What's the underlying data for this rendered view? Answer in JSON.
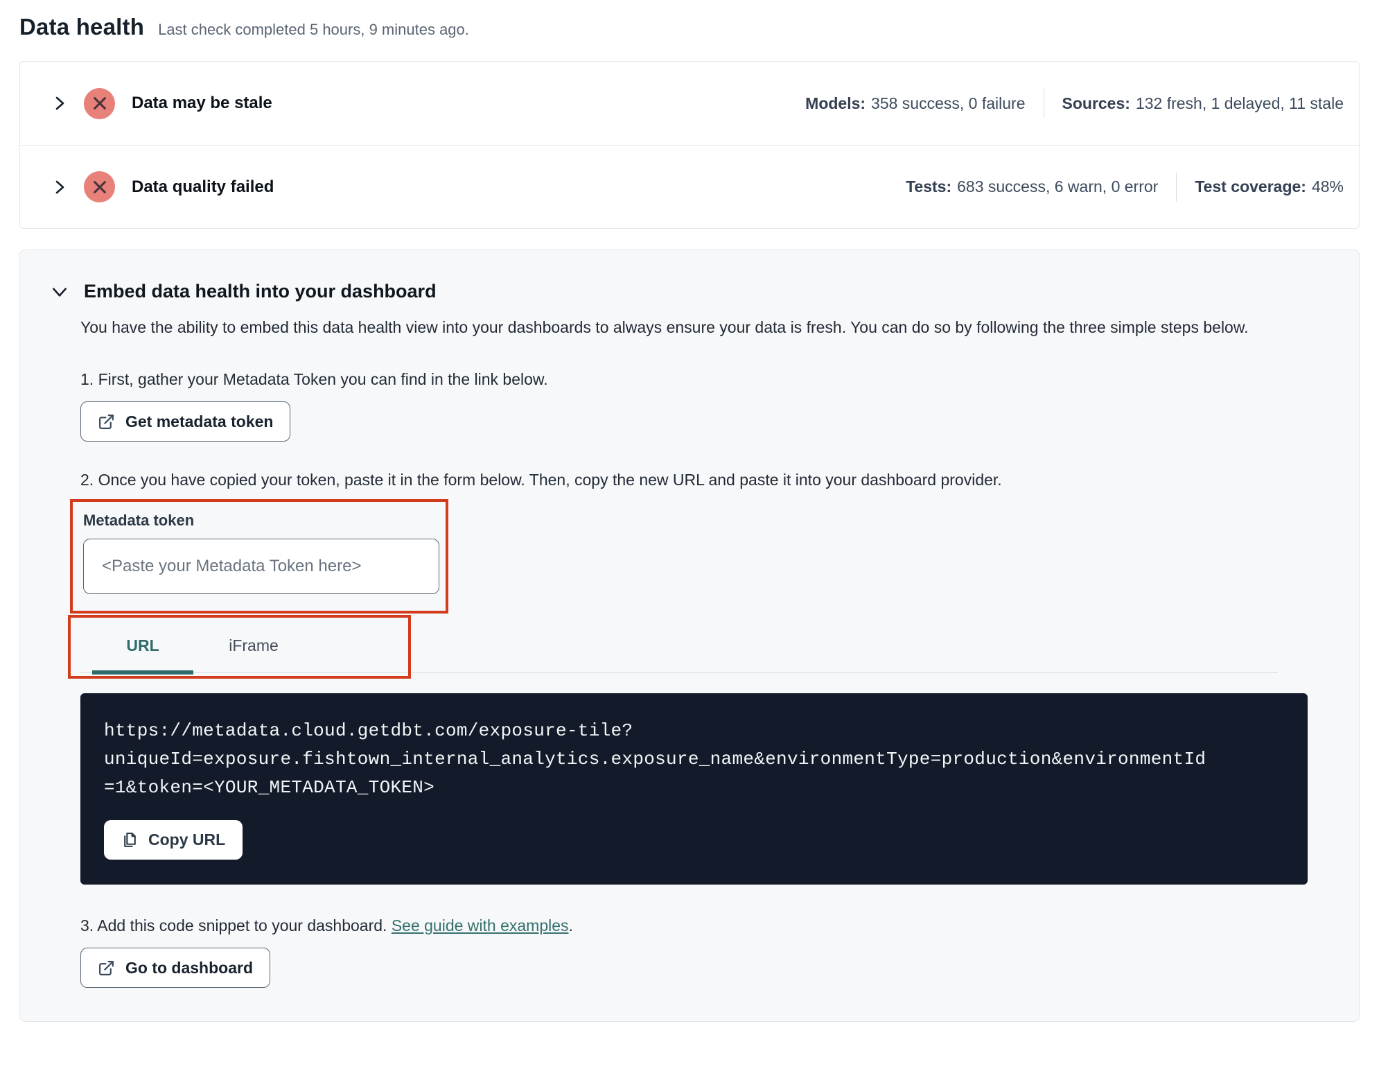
{
  "page": {
    "title": "Data health",
    "subtitle": "Last check completed 5 hours, 9 minutes ago."
  },
  "status_rows": [
    {
      "label": "Data may be stale",
      "status_icon": "error-x-circle",
      "stats": [
        {
          "label": "Models:",
          "value": "358 success, 0 failure"
        },
        {
          "label": "Sources:",
          "value": "132 fresh, 1 delayed, 11 stale"
        }
      ]
    },
    {
      "label": "Data quality failed",
      "status_icon": "error-x-circle",
      "stats": [
        {
          "label": "Tests:",
          "value": "683 success, 6 warn, 0 error"
        },
        {
          "label": "Test coverage:",
          "value": "48%"
        }
      ]
    }
  ],
  "embed": {
    "heading": "Embed data health into your dashboard",
    "description": "You have the ability to embed this data health view into your dashboards to always ensure your data is fresh. You can do so by following the three simple steps below.",
    "step1": "1. First, gather your Metadata Token you can find in the link below.",
    "get_token_button": "Get metadata token",
    "step2": "2. Once you have copied your token, paste it in the form below. Then, copy the new URL and paste it into your dashboard provider.",
    "token_field": {
      "label": "Metadata token",
      "value": "",
      "placeholder": "<Paste your Metadata Token here>"
    },
    "tabs": [
      {
        "label": "URL",
        "active": true
      },
      {
        "label": "iFrame",
        "active": false
      }
    ],
    "code_lines": [
      "https://metadata.cloud.getdbt.com/exposure-tile?",
      "uniqueId=exposure.fishtown_internal_analytics.exposure_name&environmentType=production&environmentId",
      "=1&token=<YOUR_METADATA_TOKEN>"
    ],
    "copy_button": "Copy URL",
    "step3_prefix": "3. Add this code snippet to your dashboard. ",
    "step3_link": "See guide with examples",
    "step3_suffix": ".",
    "dashboard_button": "Go to dashboard"
  },
  "colors": {
    "accent_teal": "#2e6b6a",
    "error_circle": "#e7817a",
    "annotation_red": "#d23c1c",
    "code_background": "#131a29",
    "card_background": "#f7f8f9"
  }
}
